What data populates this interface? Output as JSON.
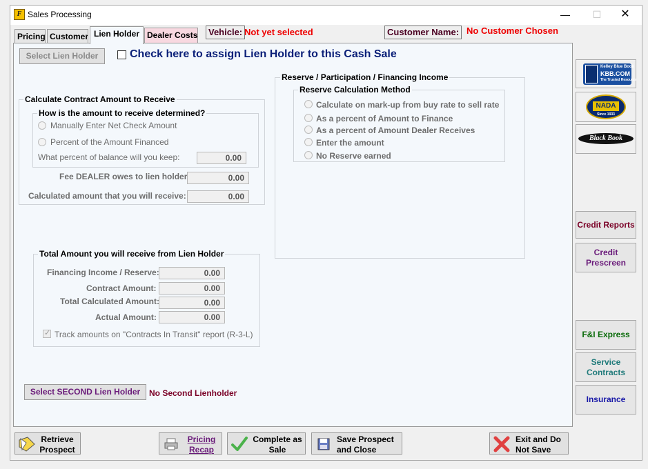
{
  "window": {
    "title": "Sales Processing",
    "controls": {
      "minimize": "—",
      "maximize": "☐",
      "close": "✕"
    }
  },
  "tabs": [
    {
      "label": "Pricing"
    },
    {
      "label": "Customer"
    },
    {
      "label": "Lien Holder",
      "active": true
    },
    {
      "label": "Dealer Costs"
    }
  ],
  "header": {
    "vehicle_label": "Vehicle:",
    "vehicle_value": "Not yet selected",
    "customer_label": "Customer Name:",
    "customer_value": "No Customer Chosen"
  },
  "lien": {
    "select_button": "Select Lien Holder",
    "assign_checkbox_label": "Check here to assign Lien Holder to this Cash Sale"
  },
  "contract": {
    "group_title": "Calculate Contract Amount to Receive",
    "sub_title": "How is the amount to receive determined?",
    "option_manual": "Manually Enter Net Check Amount",
    "option_percent": "Percent of the Amount Financed",
    "percent_label": "What percent of balance will you keep:",
    "percent_value": "0.00",
    "fee_label": "Fee DEALER owes to lien holder:",
    "fee_value": "0.00",
    "calc_label": "Calculated amount that you will receive:",
    "calc_value": "0.00"
  },
  "total": {
    "group_title": "Total Amount you will receive from Lien Holder",
    "financing_label": "Financing Income / Reserve:",
    "financing_value": "0.00",
    "contract_label": "Contract Amount:",
    "contract_value": "0.00",
    "total_calc_label": "Total Calculated Amount:",
    "total_calc_value": "0.00",
    "actual_label": "Actual Amount:",
    "actual_value": "0.00",
    "track_label": "Track amounts on \"Contracts In Transit\" report (R-3-L)",
    "track_checked": true
  },
  "reserve": {
    "group_title": "Reserve / Participation / Financing Income",
    "sub_title": "Reserve Calculation Method",
    "options": [
      "Calculate on mark-up from buy rate to sell rate",
      "As a percent of Amount to Finance",
      "As a percent of Amount Dealer Receives",
      "Enter the amount",
      "No Reserve earned"
    ]
  },
  "second_lien": {
    "button": "Select SECOND Lien Holder",
    "status": "No Second Lienholder"
  },
  "sidebar": {
    "kbb_logo": {
      "line1": "Kelley Blue Book",
      "line2": "KBB.COM",
      "line3": "The Trusted Resource"
    },
    "nada_logo": {
      "text": "NADA",
      "sub": "Since 1933"
    },
    "blackbook_logo": {
      "text": "Black Book"
    },
    "credit_reports": "Credit Reports",
    "credit_prescreen_line1": "Credit",
    "credit_prescreen_line2": "Prescreen",
    "fi_express": "F&I Express",
    "service_contracts_line1": "Service",
    "service_contracts_line2": "Contracts",
    "insurance": "Insurance"
  },
  "bottom": {
    "retrieve_line1": "Retrieve",
    "retrieve_line2": "Prospect",
    "pricing_line1": "Pricing",
    "pricing_line2": "Recap",
    "complete_line1": "Complete as",
    "complete_line2": "Sale",
    "save_line1": "Save Prospect",
    "save_line2": "and Close",
    "exit_line1": "Exit and Do",
    "exit_line2": "Not Save"
  },
  "colors": {
    "error_red": "#e00000",
    "maroon": "#7a0026",
    "purple": "#6a1b7a",
    "teal": "#1f7a7a",
    "green": "#0a6b0a",
    "blue": "#1a1aa8",
    "navy": "#0a1f78",
    "panel_bg": "#f4f8fc"
  }
}
